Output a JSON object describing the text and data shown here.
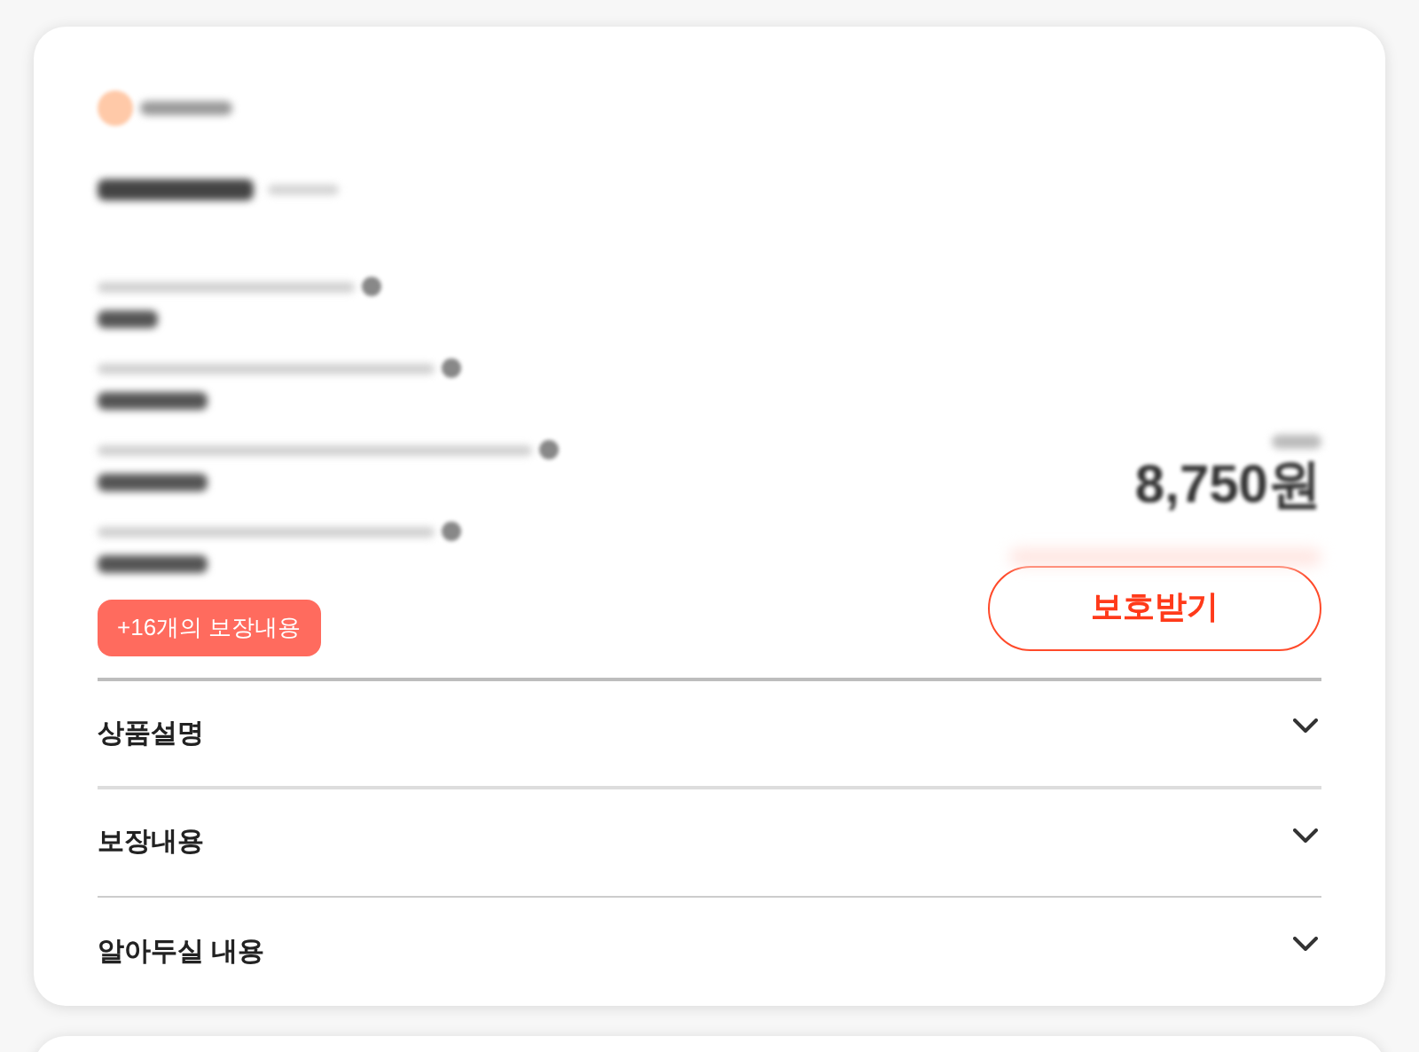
{
  "plan": {
    "more_coverage_badge": "+16개의 보장내용",
    "price": "8,750원",
    "apply_button": "보호받기"
  },
  "sections": [
    {
      "title": "상품설명",
      "expanded": false
    },
    {
      "title": "보장내용",
      "expanded": false
    },
    {
      "title": "알아두실 내용",
      "expanded": false
    }
  ]
}
